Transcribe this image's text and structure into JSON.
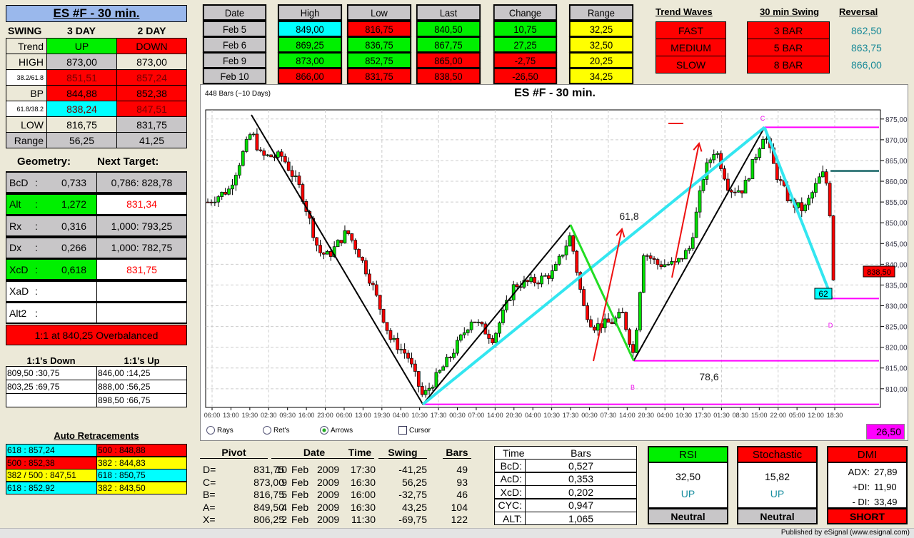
{
  "left": {
    "title": "ES #F - 30 min.",
    "swing": {
      "headers": [
        "SWING",
        "3 DAY",
        "2 DAY"
      ],
      "rows": [
        {
          "label": "Trend",
          "a": "UP",
          "b": "DOWN"
        },
        {
          "label": "HIGH",
          "a": "873,00",
          "b": "873,00"
        },
        {
          "label": "38.2/61.8",
          "a": "851,51",
          "b": "857,24"
        },
        {
          "label": "BP",
          "a": "844,88",
          "b": "852,38"
        },
        {
          "label": "61.8/38.2",
          "a": "838,24",
          "b": "847,51"
        },
        {
          "label": "LOW",
          "a": "816,75",
          "b": "831,75"
        },
        {
          "label": "Range",
          "a": "56,25",
          "b": "41,25"
        }
      ]
    },
    "geometry": {
      "header": "Geometry:",
      "target_header": "Next Target:",
      "rows": [
        {
          "label": "BcD",
          "sep": ":",
          "value": "0,733",
          "target": "0,786: 828,78"
        },
        {
          "label": "Alt",
          "sep": ":",
          "value": "1,272",
          "target": "831,34"
        },
        {
          "label": "Rx",
          "sep": ":",
          "value": "0,316",
          "target": "1,000: 793,25"
        },
        {
          "label": "Dx",
          "sep": ":",
          "value": "0,266",
          "target": "1,000: 782,75"
        },
        {
          "label": "XcD",
          "sep": ":",
          "value": "0,618",
          "target": "831,75"
        },
        {
          "label": "XaD",
          "sep": ":",
          "value": "",
          "target": ""
        },
        {
          "label": "Alt2",
          "sep": ":",
          "value": "",
          "target": ""
        }
      ],
      "status": "1:1 at 840,25 Overbalanced"
    },
    "ones": {
      "down_header": "1:1's Down",
      "up_header": "1:1's Up",
      "down": [
        "809,50 :30,75",
        "803,25 :69,75",
        ""
      ],
      "up": [
        "846,00 :14,25",
        "888,00 :56,25",
        "898,50 :66,75"
      ]
    },
    "retrace": {
      "title": "Auto Retracements",
      "rows": [
        [
          "618 : 857,24",
          "500 : 848,88"
        ],
        [
          "500 : 852,38",
          "382 : 844,83"
        ],
        [
          "382 / 500 : 847,51",
          "618 : 850,75"
        ],
        [
          "618 : 852,92",
          "382 : 843,50"
        ]
      ]
    }
  },
  "daily": {
    "headers": {
      "date": "Date",
      "high": "High",
      "low": "Low",
      "last": "Last",
      "change": "Change",
      "range": "Range"
    },
    "rows": [
      {
        "date": "Feb  5",
        "high": "849,00",
        "low": "816,75",
        "last": "840,50",
        "change": "10,75",
        "range": "32,25"
      },
      {
        "date": "Feb  6",
        "high": "869,25",
        "low": "836,75",
        "last": "867,75",
        "change": "27,25",
        "range": "32,50"
      },
      {
        "date": "Feb  9",
        "high": "873,00",
        "low": "852,75",
        "last": "865,00",
        "change": "-2,75",
        "range": "20,25"
      },
      {
        "date": "Feb  10",
        "high": "866,00",
        "low": "831,75",
        "last": "838,50",
        "change": "-26,50",
        "range": "34,25"
      }
    ]
  },
  "trend": {
    "waves_header": "Trend Waves",
    "swing_header": "30 min Swing",
    "reversal_header": "Reversal",
    "waves": [
      "FAST",
      "MEDIUM",
      "SLOW"
    ],
    "swing": [
      "3 BAR",
      "5 BAR",
      "8 BAR"
    ],
    "reversal": [
      "862,50",
      "863,75",
      "866,00"
    ]
  },
  "chart": {
    "bars_label": "448 Bars (~10 Days)",
    "title": "ES #F - 30 min.",
    "last_price": "838,50",
    "box_value": "26,50",
    "options": {
      "rays": "Rays",
      "rets": "Ret's",
      "arrows": "Arrows",
      "cursor": "Cursor"
    },
    "labels": {
      "fib1": "61,8",
      "fib2": "78,6",
      "fib3": "62",
      "C": "C",
      "B": "B",
      "D": "D"
    }
  },
  "chart_data": {
    "type": "candlestick",
    "title": "ES #F - 30 min.",
    "bars": 448,
    "ylim": [
      805.5,
      877.2
    ],
    "yticks": [
      810,
      815,
      820,
      825,
      830,
      835,
      840,
      845,
      850,
      855,
      860,
      865,
      870,
      875
    ],
    "ytick_labels": [
      "810,00",
      "815,00",
      "820,00",
      "825,00",
      "830,00",
      "835,00",
      "840,00",
      "845,00",
      "850,00",
      "855,00",
      "860,00",
      "865,00",
      "870,00",
      "875,00"
    ],
    "xtick_labels": [
      "06:00",
      "13:00",
      "19:30",
      "02:30",
      "09:30",
      "16:00",
      "23:00",
      "06:00",
      "13:00",
      "19:30",
      "04:00",
      "10:30",
      "17:30",
      "00:30",
      "07:00",
      "14:00",
      "20:30",
      "04:00",
      "10:30",
      "17:30",
      "00:30",
      "07:30",
      "14:00",
      "20:30",
      "04:00",
      "10:30",
      "17:30",
      "01:30",
      "08:30",
      "15:00",
      "22:00",
      "05:00",
      "12:00",
      "18:30"
    ],
    "price_path": [
      [
        0,
        855
      ],
      [
        15,
        858
      ],
      [
        31,
        872
      ],
      [
        38,
        866
      ],
      [
        53,
        866
      ],
      [
        66,
        858
      ],
      [
        79,
        843
      ],
      [
        86,
        842
      ],
      [
        99,
        848
      ],
      [
        107,
        843
      ],
      [
        117,
        835
      ],
      [
        130,
        822
      ],
      [
        142,
        818
      ],
      [
        153,
        808
      ],
      [
        173,
        818
      ],
      [
        188,
        827
      ],
      [
        203,
        822
      ],
      [
        218,
        835
      ],
      [
        234,
        836
      ],
      [
        246,
        838
      ],
      [
        258,
        847
      ],
      [
        267,
        830
      ],
      [
        274,
        825
      ],
      [
        287,
        826
      ],
      [
        295,
        828
      ],
      [
        303,
        818
      ],
      [
        310,
        843
      ],
      [
        320,
        840
      ],
      [
        333,
        840
      ],
      [
        343,
        844
      ],
      [
        353,
        862
      ],
      [
        361,
        868
      ],
      [
        371,
        858
      ],
      [
        381,
        858
      ],
      [
        396,
        872
      ],
      [
        404,
        862
      ],
      [
        414,
        855
      ],
      [
        424,
        853
      ],
      [
        437,
        862
      ],
      [
        442,
        858
      ],
      [
        444,
        836
      ],
      [
        447,
        838.5
      ]
    ],
    "pivots": {
      "start": [
        31,
        876
      ],
      "X": [
        153,
        806.25
      ],
      "A": [
        258,
        849.5
      ],
      "B": [
        303,
        816.75
      ],
      "C": [
        396,
        873
      ],
      "D": [
        444,
        831.75
      ]
    },
    "levels": {
      "C_level": 873,
      "D_level": 831.75,
      "B_level": 816.75,
      "X_level": 806.25,
      "reversal": 862.5
    }
  },
  "pivots": {
    "headers": [
      "Pivot",
      "Date",
      "Time",
      "Swing",
      "Bars"
    ],
    "rows": [
      {
        "p": "D=",
        "v": "831,75",
        "d": "10",
        "m": "Feb",
        "y": "2009",
        "t": "17:30",
        "s": "-41,25",
        "b": "49"
      },
      {
        "p": "C=",
        "v": "873,00",
        "d": "9",
        "m": "Feb",
        "y": "2009",
        "t": "16:30",
        "s": "56,25",
        "b": "93"
      },
      {
        "p": "B=",
        "v": "816,75",
        "d": "5",
        "m": "Feb",
        "y": "2009",
        "t": "16:00",
        "s": "-32,75",
        "b": "46"
      },
      {
        "p": "A=",
        "v": "849,50",
        "d": "4",
        "m": "Feb",
        "y": "2009",
        "t": "16:30",
        "s": "43,25",
        "b": "104"
      },
      {
        "p": "X=",
        "v": "806,25",
        "d": "2",
        "m": "Feb",
        "y": "2009",
        "t": "11:30",
        "s": "-69,75",
        "b": "122"
      }
    ]
  },
  "timebars": {
    "headers": [
      "Time",
      "Bars"
    ],
    "rows": [
      [
        "BcD:",
        "0,527"
      ],
      [
        "AcD:",
        "0,353"
      ],
      [
        "XcD:",
        "0,202"
      ],
      [
        "CYC:",
        "0,947"
      ],
      [
        "ALT:",
        "1,065"
      ]
    ]
  },
  "indicators": {
    "rsi": {
      "title": "RSI",
      "value": "32,50",
      "dir": "UP",
      "signal": "Neutral"
    },
    "stoch": {
      "title": "Stochastic",
      "value": "15,82",
      "dir": "UP",
      "signal": "Neutral"
    },
    "dmi": {
      "title": "DMI",
      "adx_label": "ADX:",
      "adx": "27,89",
      "pdi_label": "+DI:",
      "pdi": "11,90",
      "mdi_label": "- DI:",
      "mdi": "33,49",
      "signal": "SHORT"
    }
  },
  "footer": "Published by eSignal (www.esignal.com)"
}
